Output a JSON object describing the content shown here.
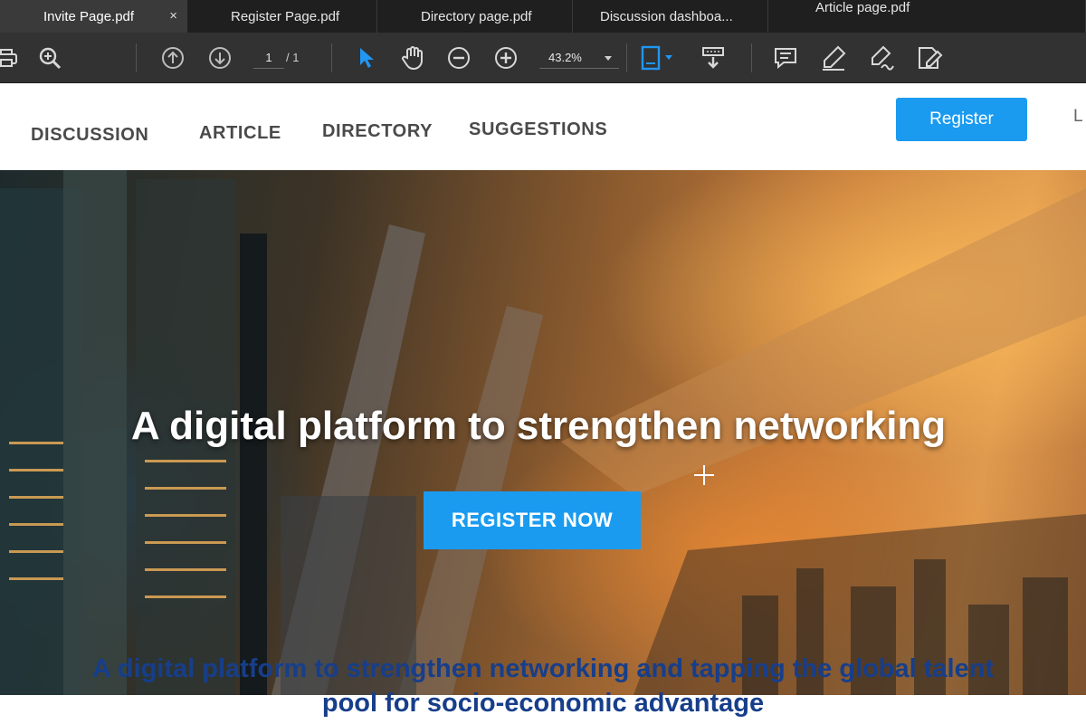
{
  "tabs": [
    {
      "label": "Invite Page.pdf",
      "active": true
    },
    {
      "label": "Register Page.pdf",
      "active": false
    },
    {
      "label": "Directory page.pdf",
      "active": false
    },
    {
      "label": "Discussion dashboa...",
      "active": false
    },
    {
      "label": "Article page.pdf",
      "active": false
    }
  ],
  "tab_close_glyph": "×",
  "toolbar": {
    "page_current": "1",
    "page_total": "/ 1",
    "zoom": "43.2%",
    "icons": [
      "print-icon",
      "zoom-search-icon",
      "page-up-icon",
      "page-down-icon",
      "select-pointer-icon",
      "hand-tool-icon",
      "zoom-out-icon",
      "zoom-in-icon",
      "fit-page-icon",
      "scroll-mode-icon",
      "comment-icon",
      "highlight-icon",
      "sign-icon",
      "edit-pdf-icon"
    ],
    "accent_color": "#2196f3"
  },
  "nav": {
    "items": [
      "DISCUSSION",
      "ARTICLE",
      "DIRECTORY",
      "SUGGESTIONS"
    ],
    "register_label": "Register",
    "cut_label": "L"
  },
  "hero": {
    "title": "A digital platform to strengthen networking",
    "cta_label": "REGISTER NOW"
  },
  "tagline": {
    "line1": "A digital platform to strengthen networking and tapping the global talent",
    "line2": "pool for socio-economic advantage"
  },
  "colors": {
    "brand_blue": "#1a9bf0",
    "tagline_blue": "#173e8a",
    "toolbar_bg": "#323232"
  }
}
